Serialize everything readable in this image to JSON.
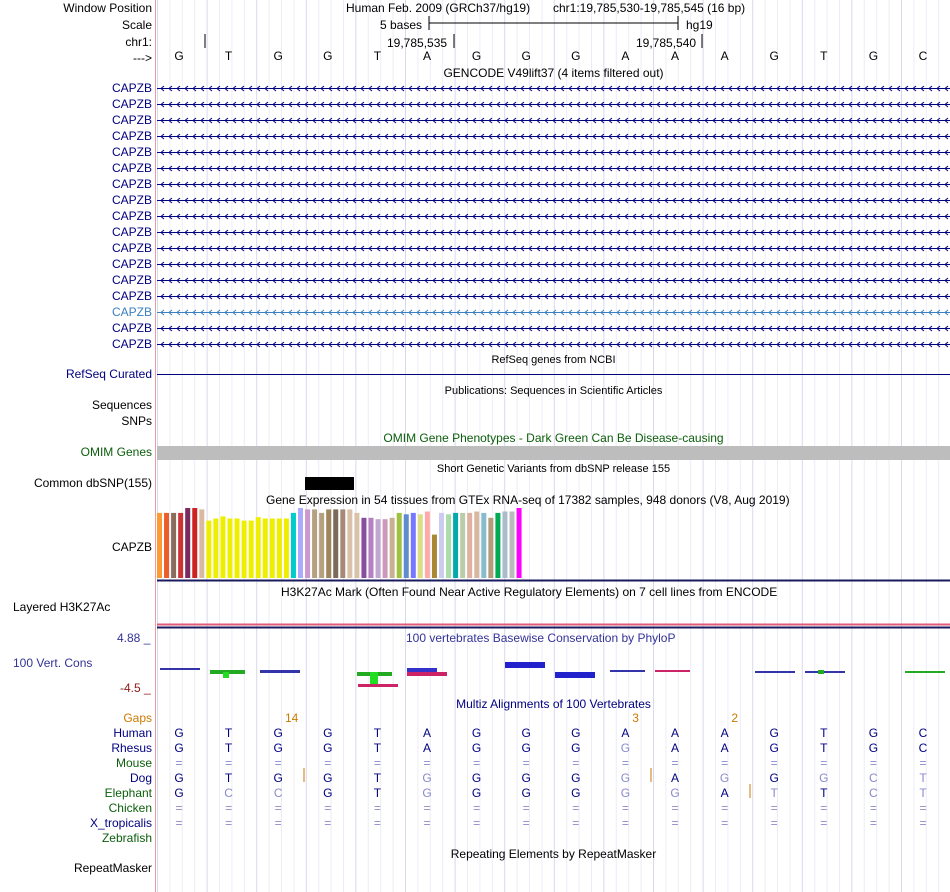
{
  "header": {
    "window_position_label": "Window Position",
    "scale_label": "Scale",
    "chrom_label": "chr1:",
    "strand_label": "--->",
    "assembly_text": "Human Feb. 2009 (GRCh37/hg19)",
    "position_text": "chr1:19,785,530-19,785,545 (16 bp)",
    "scale_text": "5 bases",
    "db_text": "hg19",
    "tick1": "19,785,535",
    "tick2": "19,785,540"
  },
  "bases": [
    "G",
    "T",
    "G",
    "G",
    "T",
    "A",
    "G",
    "G",
    "G",
    "A",
    "A",
    "A",
    "G",
    "T",
    "G",
    "C"
  ],
  "gencode": {
    "title": "GENCODE V49lift37 (4 items filtered out)",
    "rows": [
      "CAPZB",
      "CAPZB",
      "CAPZB",
      "CAPZB",
      "CAPZB",
      "CAPZB",
      "CAPZB",
      "CAPZB",
      "CAPZB",
      "CAPZB",
      "CAPZB",
      "CAPZB",
      "CAPZB",
      "CAPZB",
      "CAPZB",
      "CAPZB",
      "CAPZB"
    ],
    "highlight_color": "#3a7fbf",
    "color": "#000080"
  },
  "refseq": {
    "title": "RefSeq genes from NCBI",
    "label": "RefSeq Curated"
  },
  "publications": {
    "title": "Publications: Sequences in Scientific Articles",
    "label1": "Sequences",
    "label2": "SNPs"
  },
  "omim": {
    "title": "OMIM Gene Phenotypes - Dark Green Can Be Disease-causing",
    "label": "OMIM Genes",
    "color": "#0b5e0b"
  },
  "dbsnp": {
    "title": "Short Genetic Variants from dbSNP release 155",
    "label": "Common dbSNP(155)"
  },
  "gtex": {
    "title": "Gene Expression in 54 tissues from GTEx RNA-seq of 17382 samples, 948 donors (V8, Aug 2019)",
    "label": "CAPZB",
    "bars": [
      {
        "c": "#ff9933",
        "v": 0.93
      },
      {
        "c": "#ee5c2c",
        "v": 0.93
      },
      {
        "c": "#8b6b5b",
        "v": 0.93
      },
      {
        "c": "#cc3333",
        "v": 0.93
      },
      {
        "c": "#7a2a5e",
        "v": 1.0
      },
      {
        "c": "#cc2222",
        "v": 1.0
      },
      {
        "c": "#d9b9a0",
        "v": 0.98
      },
      {
        "c": "#eeee00",
        "v": 0.82
      },
      {
        "c": "#eeee00",
        "v": 0.85
      },
      {
        "c": "#eeee00",
        "v": 0.88
      },
      {
        "c": "#eeee00",
        "v": 0.85
      },
      {
        "c": "#eeee00",
        "v": 0.85
      },
      {
        "c": "#eeee00",
        "v": 0.82
      },
      {
        "c": "#eeee00",
        "v": 0.82
      },
      {
        "c": "#eeee00",
        "v": 0.87
      },
      {
        "c": "#eeee00",
        "v": 0.85
      },
      {
        "c": "#eeee00",
        "v": 0.85
      },
      {
        "c": "#eeee00",
        "v": 0.85
      },
      {
        "c": "#eeee00",
        "v": 0.85
      },
      {
        "c": "#00cccc",
        "v": 0.93
      },
      {
        "c": "#aaaaff",
        "v": 1.0
      },
      {
        "c": "#cc99cc",
        "v": 0.98
      },
      {
        "c": "#b5a080",
        "v": 0.98
      },
      {
        "c": "#b5a080",
        "v": 0.93
      },
      {
        "c": "#a0845c",
        "v": 0.98
      },
      {
        "c": "#7a6a5a",
        "v": 0.98
      },
      {
        "c": "#aa8877",
        "v": 0.98
      },
      {
        "c": "#d9c2a8",
        "v": 0.98
      },
      {
        "c": "#d9c2a8",
        "v": 0.93
      },
      {
        "c": "#8a4da0",
        "v": 0.86
      },
      {
        "c": "#b482c0",
        "v": 0.86
      },
      {
        "c": "#c0a8d0",
        "v": 0.84
      },
      {
        "c": "#cc99bb",
        "v": 0.84
      },
      {
        "c": "#c8b090",
        "v": 0.86
      },
      {
        "c": "#a0c040",
        "v": 0.93
      },
      {
        "c": "#5e8ccc",
        "v": 0.91
      },
      {
        "c": "#7777ff",
        "v": 0.93
      },
      {
        "c": "#dddd88",
        "v": 0.91
      },
      {
        "c": "#ffaaaa",
        "v": 0.95
      },
      {
        "c": "#aa8833",
        "v": 0.62
      },
      {
        "c": "#ccccee",
        "v": 0.93
      },
      {
        "c": "#aaddaa",
        "v": 0.91
      },
      {
        "c": "#00aaaa",
        "v": 0.93
      },
      {
        "c": "#bbccaa",
        "v": 0.93
      },
      {
        "c": "#e0b0a0",
        "v": 0.93
      },
      {
        "c": "#d8b8a0",
        "v": 0.95
      },
      {
        "c": "#88bbcc",
        "v": 0.93
      },
      {
        "c": "#b59b7c",
        "v": 0.86
      },
      {
        "c": "#00aa55",
        "v": 0.93
      },
      {
        "c": "#aabbcc",
        "v": 0.95
      },
      {
        "c": "#bbbbbb",
        "v": 0.95
      },
      {
        "c": "#ff00ff",
        "v": 1.0
      }
    ]
  },
  "h3k27ac": {
    "title": "H3K27Ac Mark (Often Found Near Active Regulatory Elements) on 7 cell lines from ENCODE",
    "label": "Layered H3K27Ac"
  },
  "cons": {
    "title": "100 vertebrates Basewise Conservation by PhyloP",
    "label": "100 Vert. Cons",
    "max_label": "4.88 _",
    "min_label": "-4.5 _",
    "color": "#333399"
  },
  "multiz": {
    "title": "Multiz Alignments of 100 Vertebrates",
    "gaps_label": "Gaps",
    "gap_numbers": [
      {
        "pos": 2.5,
        "text": "14"
      },
      {
        "pos": 9.5,
        "text": "3"
      },
      {
        "pos": 11.5,
        "text": "2"
      }
    ],
    "species": [
      {
        "name": "Human",
        "color": "#000080",
        "seq": [
          "G",
          "T",
          "G",
          "G",
          "T",
          "A",
          "G",
          "G",
          "G",
          "A",
          "A",
          "A",
          "G",
          "T",
          "G",
          "C"
        ]
      },
      {
        "name": "Rhesus",
        "color": "#000080",
        "seq": [
          "G",
          "T",
          "G",
          "G",
          "T",
          "A",
          "G",
          "G",
          "G",
          "G",
          "A",
          "A",
          "G",
          "T",
          "G",
          "C"
        ]
      },
      {
        "name": "Mouse",
        "color": "#0b5e0b",
        "seq": [
          "=",
          "=",
          "=",
          "=",
          "=",
          "=",
          "=",
          "=",
          "=",
          "=",
          "=",
          "=",
          "=",
          "=",
          "=",
          "="
        ]
      },
      {
        "name": "Dog",
        "color": "#000080",
        "seq": [
          "G",
          "T",
          "G",
          "G",
          "T",
          "G",
          "G",
          "G",
          "G",
          "G",
          "A",
          "G",
          "G",
          "G",
          "C",
          "T"
        ]
      },
      {
        "name": "Elephant",
        "color": "#0b5e0b",
        "seq": [
          "G",
          "C",
          "C",
          "G",
          "T",
          "G",
          "G",
          "G",
          "G",
          "G",
          "G",
          "A",
          "T",
          "T",
          "C",
          "T"
        ]
      },
      {
        "name": "Chicken",
        "color": "#0b5e0b",
        "seq": [
          "=",
          "=",
          "=",
          "=",
          "=",
          "=",
          "=",
          "=",
          "=",
          "=",
          "=",
          "=",
          "=",
          "=",
          "=",
          "="
        ]
      },
      {
        "name": "X_tropicalis",
        "color": "#000080",
        "seq": [
          "=",
          "=",
          "=",
          "=",
          "=",
          "=",
          "=",
          "=",
          "=",
          "=",
          "=",
          "=",
          "=",
          "=",
          "=",
          "="
        ]
      },
      {
        "name": "Zebrafish",
        "color": "#0b5e0b",
        "seq": []
      }
    ],
    "gaps_color": "#cc7a00"
  },
  "repeatmasker": {
    "title": "Repeating Elements by RepeatMasker",
    "label": "RepeatMasker"
  }
}
